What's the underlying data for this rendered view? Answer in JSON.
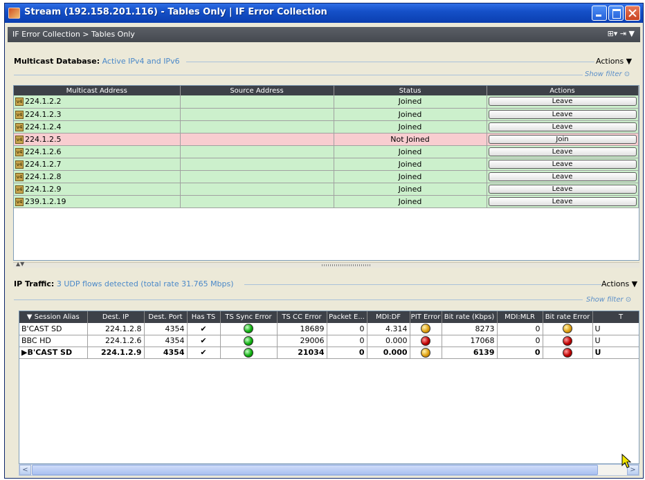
{
  "window": {
    "title": "Stream (192.158.201.116) - Tables Only | IF Error Collection"
  },
  "breadcrumb": "IF Error Collection > Tables Only",
  "multicast": {
    "title": "Multicast Database:",
    "subtitle": "Active IPv4 and IPv6",
    "actions_label": "Actions ▼",
    "show_filter": "Show filter",
    "columns": [
      "Multicast Address",
      "Source Address",
      "Status",
      "Actions"
    ],
    "rows": [
      {
        "address": "224.1.2.2",
        "source": "",
        "status": "Joined",
        "action": "Leave"
      },
      {
        "address": "224.1.2.3",
        "source": "",
        "status": "Joined",
        "action": "Leave"
      },
      {
        "address": "224.1.2.4",
        "source": "",
        "status": "Joined",
        "action": "Leave"
      },
      {
        "address": "224.1.2.5",
        "source": "",
        "status": "Not Joined",
        "action": "Join"
      },
      {
        "address": "224.1.2.6",
        "source": "",
        "status": "Joined",
        "action": "Leave"
      },
      {
        "address": "224.1.2.7",
        "source": "",
        "status": "Joined",
        "action": "Leave"
      },
      {
        "address": "224.1.2.8",
        "source": "",
        "status": "Joined",
        "action": "Leave"
      },
      {
        "address": "224.1.2.9",
        "source": "",
        "status": "Joined",
        "action": "Leave"
      },
      {
        "address": "239.1.2.19",
        "source": "",
        "status": "Joined",
        "action": "Leave"
      }
    ]
  },
  "ip_traffic": {
    "title": "IP Traffic:",
    "subtitle": "3 UDP flows detected (total rate 31.765 Mbps)",
    "actions_label": "Actions ▼",
    "show_filter": "Show filter",
    "columns": [
      "Session Alias",
      "Dest. IP",
      "Dest. Port",
      "Has TS",
      "TS Sync Error",
      "TS CC Error",
      "Packet E...",
      "MDI:DF",
      "PIT Error",
      "Bit rate (Kbps)",
      "MDI:MLR",
      "Bit rate Error",
      "T"
    ],
    "rows": [
      {
        "alias": "B'CAST SD",
        "ip": "224.1.2.8",
        "port": "4354",
        "has_ts": "✔",
        "sync": "green",
        "cc": "18689",
        "packet": "0",
        "df": "4.314",
        "pit": "amber",
        "bitrate": "8273",
        "mlr": "0",
        "brerr": "amber",
        "t": "U"
      },
      {
        "alias": "BBC HD",
        "ip": "224.1.2.6",
        "port": "4354",
        "has_ts": "✔",
        "sync": "green",
        "cc": "29006",
        "packet": "0",
        "df": "0.000",
        "pit": "red",
        "bitrate": "17068",
        "mlr": "0",
        "brerr": "red",
        "t": "U"
      },
      {
        "alias": "B'CAST SD",
        "ip": "224.1.2.9",
        "port": "4354",
        "has_ts": "✔",
        "sync": "green",
        "cc": "21034",
        "packet": "0",
        "df": "0.000",
        "pit": "amber",
        "bitrate": "6139",
        "mlr": "0",
        "brerr": "red",
        "t": "U"
      }
    ]
  },
  "icons": {
    "v4_badge": "v4",
    "selected_row_marker": "▶",
    "sort_marker": "▼",
    "scroll_left": "<",
    "scroll_right": ">",
    "toolbar": "⊞▾ ⇥ ▼"
  },
  "colors": {
    "joined_bg": "#ccf0cc",
    "not_joined_bg": "#f8cdd0",
    "header_bg": "#3d4148",
    "title_bar": "#1550c8"
  }
}
